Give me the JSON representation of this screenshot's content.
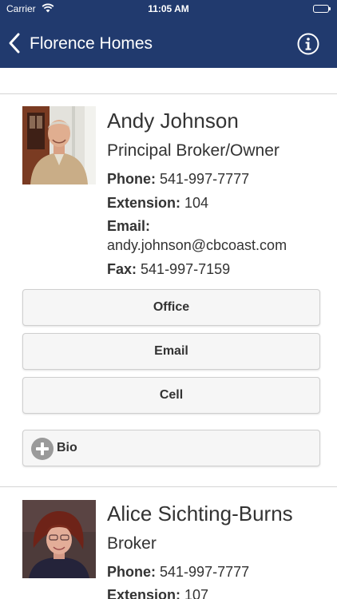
{
  "status_bar": {
    "carrier": "Carrier",
    "time": "11:05 AM",
    "battery_level": 1.0
  },
  "nav": {
    "title": "Florence Homes",
    "back_icon": "chevron-left-icon",
    "info_icon": "info-circle-icon"
  },
  "agents": [
    {
      "name": "Andy Johnson",
      "role": "Principal Broker/Owner",
      "phone_label": "Phone:",
      "phone": "541-997-7777",
      "extension_label": "Extension:",
      "extension": "104",
      "email_label": "Email:",
      "email": "andy.johnson@cbcoast.com",
      "fax_label": "Fax:",
      "fax": "541-997-7159",
      "buttons": {
        "office": "Office",
        "email": "Email",
        "cell": "Cell",
        "bio": "Bio"
      }
    },
    {
      "name": "Alice Sichting-Burns",
      "role": "Broker",
      "phone_label": "Phone:",
      "phone": "541-997-7777",
      "extension_label": "Extension:",
      "extension": "107"
    }
  ],
  "colors": {
    "nav_background": "#213a6e",
    "button_background": "#f6f6f6",
    "divider": "#d4d4d4"
  }
}
